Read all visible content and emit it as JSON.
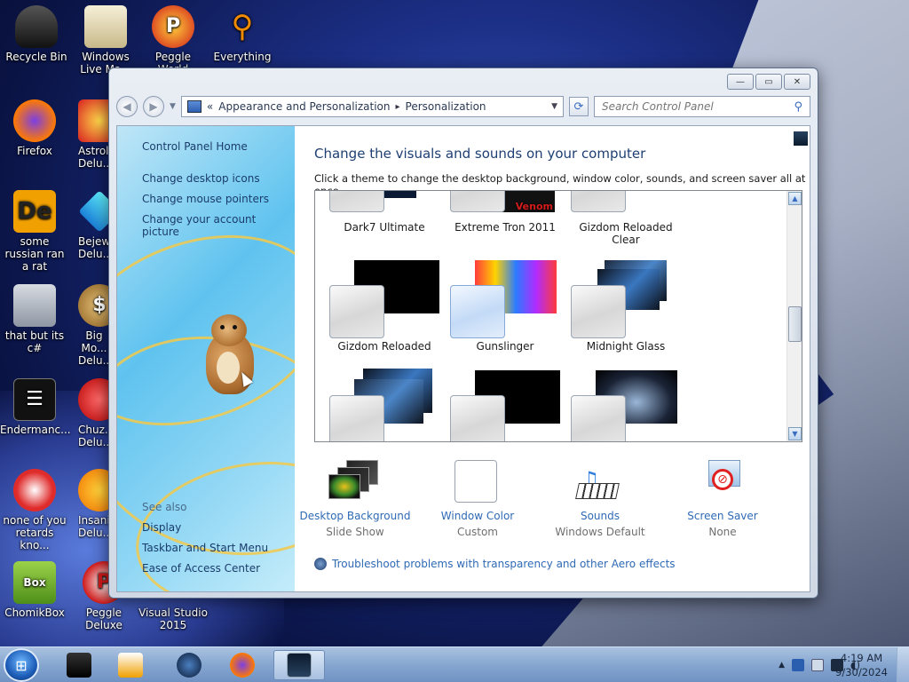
{
  "desktop": {
    "icons": [
      {
        "label": "Recycle Bin"
      },
      {
        "label": "Windows Live Ma..."
      },
      {
        "label": "Peggle World"
      },
      {
        "label": "Everything"
      },
      {
        "label": "Firefox"
      },
      {
        "label": "Astrol... Delu..."
      },
      {
        "label": "some russian ran a rat"
      },
      {
        "label": "Bejew... Delu..."
      },
      {
        "label": "that but its c#"
      },
      {
        "label": "Big Mo... Delu..."
      },
      {
        "label": "Endermanc..."
      },
      {
        "label": "Chuz... Delu..."
      },
      {
        "label": "none of you retards kno..."
      },
      {
        "label": "Insaniq... Delu..."
      },
      {
        "label": "ChomikBox"
      },
      {
        "label": "Peggle Deluxe"
      },
      {
        "label": "Visual Studio 2015"
      }
    ]
  },
  "window": {
    "controls": {
      "minimize": "—",
      "maximize": "▭",
      "close": "✕"
    },
    "breadcrumb": {
      "chevrons": "«",
      "root": "Appearance and Personalization",
      "separator": "▸",
      "current": "Personalization"
    },
    "search": {
      "placeholder": "Search Control Panel"
    }
  },
  "left_pane": {
    "home": "Control Panel Home",
    "links": [
      "Change desktop icons",
      "Change mouse pointers",
      "Change your account picture"
    ],
    "see_also_heading": "See also",
    "see_also": [
      "Display",
      "Taskbar and Start Menu",
      "Ease of Access Center"
    ]
  },
  "main": {
    "title": "Change the visuals and sounds on your computer",
    "subtitle": "Click a theme to change the desktop background, window color, sounds, and screen saver all at once.",
    "themes": [
      {
        "name": "Dark7 Ultimate"
      },
      {
        "name": "Extreme Tron 2011",
        "thumb_text": "Venom"
      },
      {
        "name": "Gizdom Reloaded Clear"
      },
      {
        "name": "Gizdom Reloaded"
      },
      {
        "name": "Gunslinger"
      },
      {
        "name": "Midnight Glass"
      }
    ],
    "settings": [
      {
        "label": "Desktop Background",
        "value": "Slide Show"
      },
      {
        "label": "Window Color",
        "value": "Custom"
      },
      {
        "label": "Sounds",
        "value": "Windows Default"
      },
      {
        "label": "Screen Saver",
        "value": "None"
      }
    ],
    "troubleshoot": "Troubleshoot problems with transparency and other Aero effects"
  },
  "taskbar": {
    "clock": {
      "time": "4:19 AM",
      "date": "9/30/2024"
    }
  },
  "colors": {
    "link": "#2f6ab5",
    "title": "#1e3f73",
    "pane": "#5fc3ef"
  }
}
